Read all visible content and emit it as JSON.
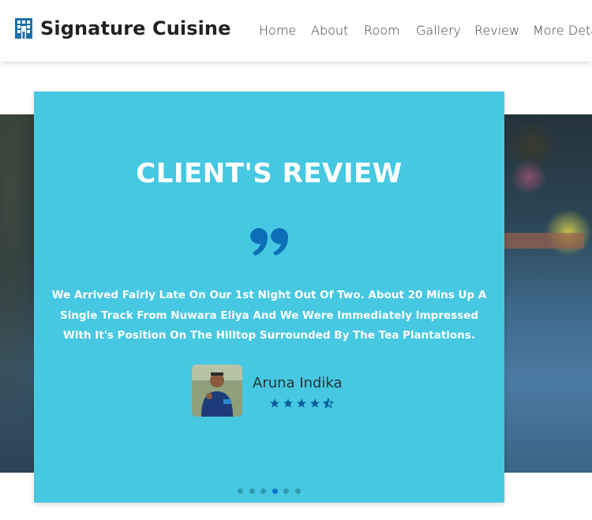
{
  "header": {
    "brand_name": "Signature Cuisine",
    "brand_icon": "hotel-building-icon",
    "brand_color": "#1a73a8",
    "nav": [
      {
        "label": "Home"
      },
      {
        "label": "About"
      },
      {
        "label": "Room"
      },
      {
        "label": "Gallery"
      },
      {
        "label": "Review"
      },
      {
        "label": "More Deta"
      }
    ]
  },
  "review": {
    "title": "CLIENT'S REVIEW",
    "quote_icon": "quote-icon",
    "text": "We Arrived Fairly Late On Our 1st Night Out Of Two. About 20 Mins Up A Single Track From Nuwara Eliya And We Were Immediately Impressed With It's Position On The Hilltop Surrounded By The Tea Plantations.",
    "reviewer_name": "Aruna Indika",
    "rating": 4.5,
    "rating_max": 5,
    "card_color": "#46c8e2",
    "accent_color": "#0b73c9"
  },
  "carousel": {
    "dot_count": 6,
    "active_index": 3
  }
}
